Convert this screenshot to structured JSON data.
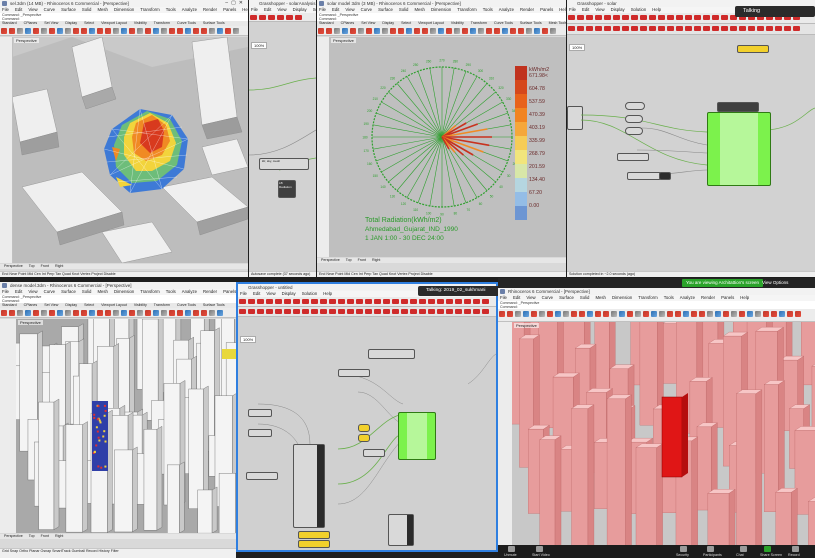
{
  "panes": {
    "p1": {
      "title": "sel.3dm (14 MB) - Rhinoceros 6 Commercial - [Perspective]",
      "menu": [
        "File",
        "Edit",
        "View",
        "Curve",
        "Surface",
        "Solid",
        "Mesh",
        "Dimension",
        "Transform",
        "Tools",
        "Analyze",
        "Render",
        "Panels",
        "Help"
      ],
      "tabs": [
        "Standard",
        "CPlanes",
        "Set View",
        "Display",
        "Select",
        "Viewport Layout",
        "Visibility",
        "Transform",
        "Curve Tools",
        "Surface Tools"
      ],
      "view": "Perspective",
      "vtabs": [
        "Perspective",
        "Top",
        "Front",
        "Right"
      ],
      "status": "End  Near  Point  Mid  Cen  Int  Perp  Tan  Quad  Knot  Vertex  Project  Disable"
    },
    "p2": {
      "title": "Grasshopper - solarAnalysis",
      "menu": [
        "File",
        "Edit",
        "View",
        "Display",
        "Solution",
        "Help"
      ],
      "status": "Autosave complete (37 seconds ago)",
      "node_title": "LB Radiation",
      "node_sub": "ldr, sky, mesh"
    },
    "p3": {
      "title": "solar model 3dm (3 MB) - Rhinoceros 6 Commercial - [Perspective]",
      "menu": [
        "File",
        "Edit",
        "View",
        "Curve",
        "Surface",
        "Solid",
        "Mesh",
        "Dimension",
        "Transform",
        "Tools",
        "Analyze",
        "Render",
        "Panels",
        "Help"
      ],
      "tabs": [
        "Standard",
        "CPlanes",
        "Set View",
        "Display",
        "Select",
        "Viewport Layout",
        "Visibility",
        "Transform",
        "Curve Tools",
        "Surface Tools",
        "Mesh Tools"
      ],
      "view": "Perspective",
      "radiation_label": "Total Radiation(kWh/m2)",
      "location": "Ahmedabad_Gujarat_IND_1990",
      "period": "1 JAN 1:00 - 30 DEC 24:00",
      "unit": "kWh/m2",
      "legend_values": [
        "671.98<",
        "604.78",
        "537.59",
        "470.39",
        "403.19",
        "335.99",
        "268.79",
        "201.59",
        "134.40",
        "67.20",
        "0.00"
      ],
      "legend_colors": [
        "#c0321e",
        "#d5481c",
        "#e8621b",
        "#f18421",
        "#f5a73b",
        "#f6cc57",
        "#f1e57c",
        "#d8e7a8",
        "#b5d6e0",
        "#94bde6",
        "#6d96d3"
      ],
      "vtabs": [
        "Perspective",
        "Top",
        "Front",
        "Right"
      ]
    },
    "p4": {
      "title": "Grasshopper - solar",
      "menu": [
        "File",
        "Edit",
        "View",
        "Display",
        "Solution",
        "Help"
      ],
      "status": "Solution completed in ~2.0 seconds (ago)",
      "zoom": "100%",
      "talking": "Talking"
    },
    "p5": {
      "title": "dense model.3dm - Rhinoceros 6 Commercial - [Perspective]",
      "menu": [
        "File",
        "Edit",
        "View",
        "Curve",
        "Surface",
        "Solid",
        "Mesh",
        "Dimension",
        "Transform",
        "Tools",
        "Analyze",
        "Render",
        "Panels",
        "Help"
      ],
      "tabs": [
        "Standard",
        "CPlanes",
        "Set View",
        "Display",
        "Select",
        "Viewport Layout",
        "Visibility",
        "Transform",
        "Curve Tools",
        "Surface Tools"
      ],
      "view": "Perspective",
      "vtabs": [
        "Perspective",
        "Top",
        "Front",
        "Right"
      ],
      "status": "Grid Snap  Ortho  Planar  Osnap  SmartTrack  Gumball  Record History  Filter"
    },
    "p6": {
      "title": "Grasshopper - untitled",
      "menu": [
        "File",
        "Edit",
        "View",
        "Display",
        "Solution",
        "Help"
      ],
      "zoom": "100%",
      "talking": "Talking: 2019_02_sukhmani"
    },
    "p7": {
      "title": "Rhinoceros 6 Commercial - [Perspective]",
      "menu": [
        "File",
        "Edit",
        "View",
        "Curve",
        "Surface",
        "Solid",
        "Mesh",
        "Dimension",
        "Transform",
        "Tools",
        "Analyze",
        "Render",
        "Panels",
        "Help"
      ],
      "view": "Perspective",
      "zoom_banner": "You are viewing Architattion's screen",
      "view_options": "View Options"
    }
  },
  "zoom_controls": [
    "Unmute",
    "Start Video",
    "Security",
    "Participants",
    "Chat",
    "Share Screen",
    "Record"
  ]
}
